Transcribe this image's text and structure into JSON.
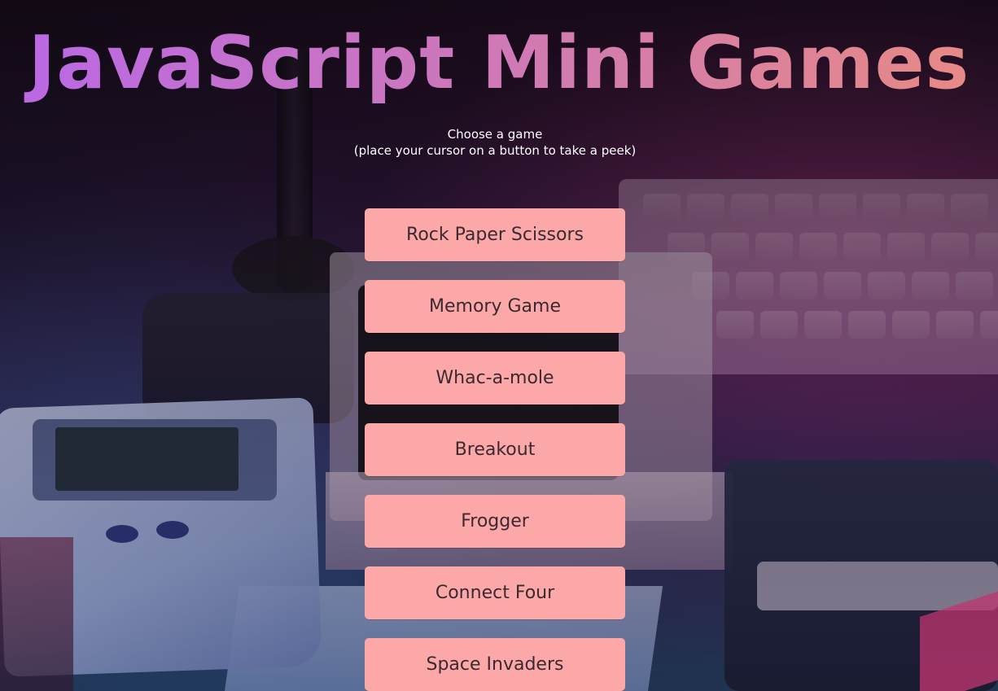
{
  "page": {
    "title": "JavaScript Mini Games",
    "subtitle_line1": "Choose a game",
    "subtitle_line2": "(place your cursor on a button to take a peek)"
  },
  "games": [
    {
      "label": "Rock Paper Scissors"
    },
    {
      "label": "Memory Game"
    },
    {
      "label": "Whac-a-mole"
    },
    {
      "label": "Breakout"
    },
    {
      "label": "Frogger"
    },
    {
      "label": "Connect Four"
    },
    {
      "label": "Space Invaders"
    }
  ],
  "colors": {
    "title_gradient_start": "#b968e6",
    "title_gradient_end": "#e88b83",
    "button_background": "#fda8a8",
    "button_text": "#3a2a30",
    "subtitle_text": "#ffffff"
  }
}
